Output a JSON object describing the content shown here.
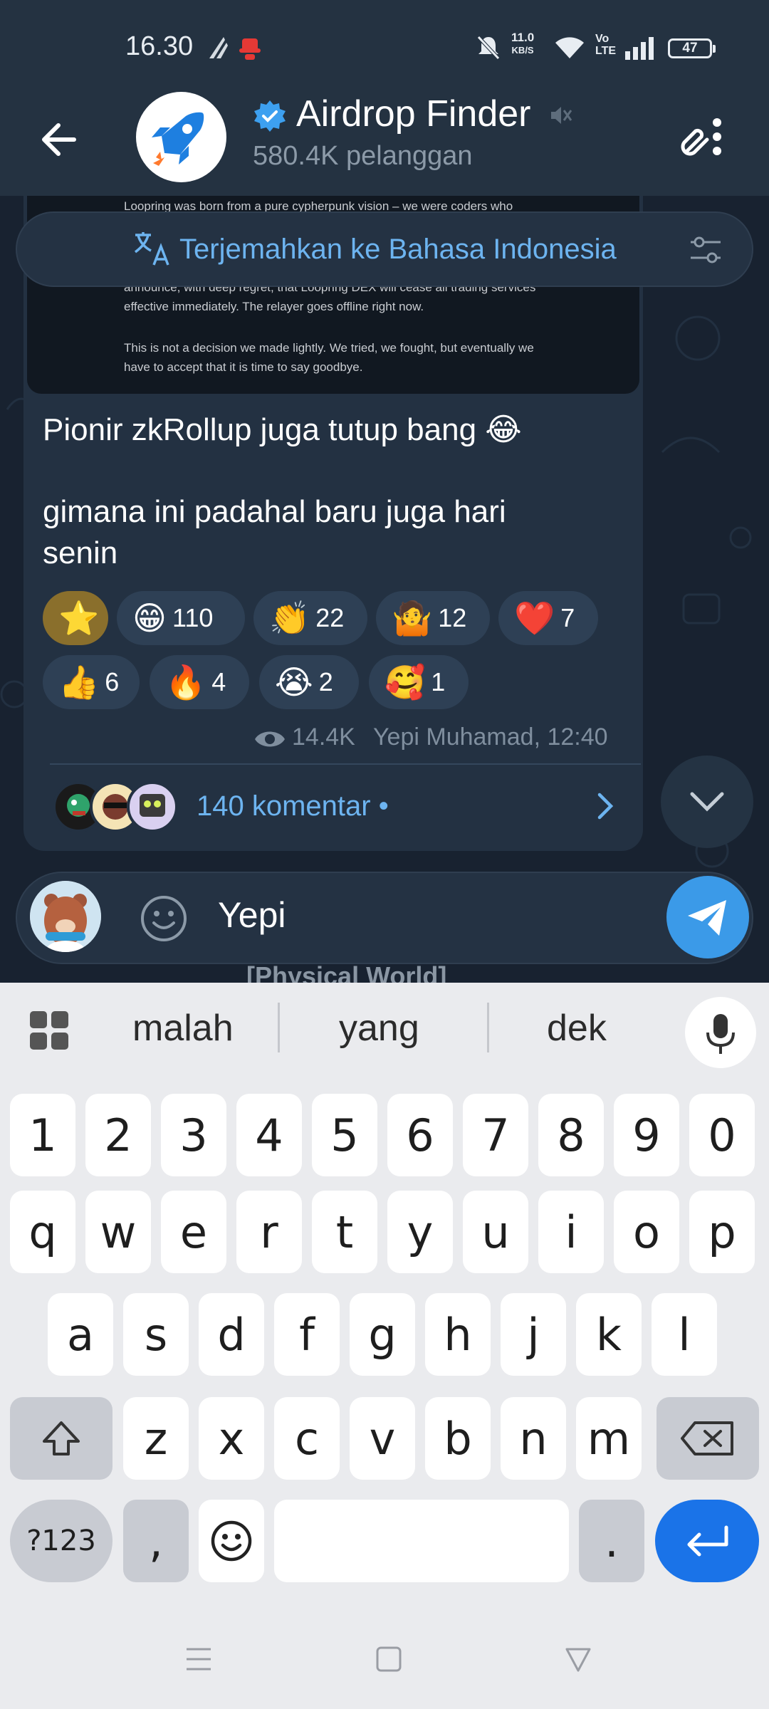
{
  "status_bar": {
    "time": "16.30",
    "speed": "11.0",
    "speed_unit": "KB/S",
    "network": "Vo LTE",
    "battery": "47"
  },
  "header": {
    "title": "Airdrop Finder",
    "subscribers": "580.4K pelanggan"
  },
  "quoted_post": {
    "lines": [
      "Loopring was born from a pure cypherpunk vision – we were coders who",
      "announce, with deep regret, that Loopring DEX will cease all trading services",
      "effective immediately. The relayer goes offline right now.",
      "This is not a decision we made lightly. We tried, we fought, but eventually we",
      "have to accept that it is time to say goodbye."
    ]
  },
  "translate_bar": {
    "label": "Terjemahkan ke Bahasa Indonesia"
  },
  "message": {
    "line1": "Pionir zkRollup juga tutup bang 😂",
    "line2": "gimana ini padahal baru juga hari",
    "line3": "senin",
    "reactions": [
      {
        "emoji": "⭐",
        "count": ""
      },
      {
        "emoji": "😁",
        "count": "110"
      },
      {
        "emoji": "👏",
        "count": "22"
      },
      {
        "emoji": "🤷",
        "count": "12"
      },
      {
        "emoji": "❤️",
        "count": "7"
      },
      {
        "emoji": "👍",
        "count": "6"
      },
      {
        "emoji": "🔥",
        "count": "4"
      },
      {
        "emoji": "😭",
        "count": "2"
      },
      {
        "emoji": "🥰",
        "count": "1"
      }
    ],
    "views": "14.4K",
    "author_time": "Yepi Muhamad, 12:40",
    "comments": "140 komentar •"
  },
  "input": {
    "text": "Yepi",
    "below_hint": "[Physical World]"
  },
  "keyboard": {
    "suggestions": [
      "malah",
      "yang",
      "dek"
    ],
    "row_numbers": [
      "1",
      "2",
      "3",
      "4",
      "5",
      "6",
      "7",
      "8",
      "9",
      "0"
    ],
    "row1": [
      "q",
      "w",
      "e",
      "r",
      "t",
      "y",
      "u",
      "i",
      "o",
      "p"
    ],
    "row2": [
      "a",
      "s",
      "d",
      "f",
      "g",
      "h",
      "j",
      "k",
      "l"
    ],
    "row3": [
      "z",
      "x",
      "c",
      "v",
      "b",
      "n",
      "m"
    ],
    "symbols_label": "?123",
    "comma": ",",
    "period": "."
  },
  "colors": {
    "accent_blue": "#3b9ae8",
    "link_blue": "#6db4f0",
    "bubble": "#233142",
    "header": "#243241"
  }
}
